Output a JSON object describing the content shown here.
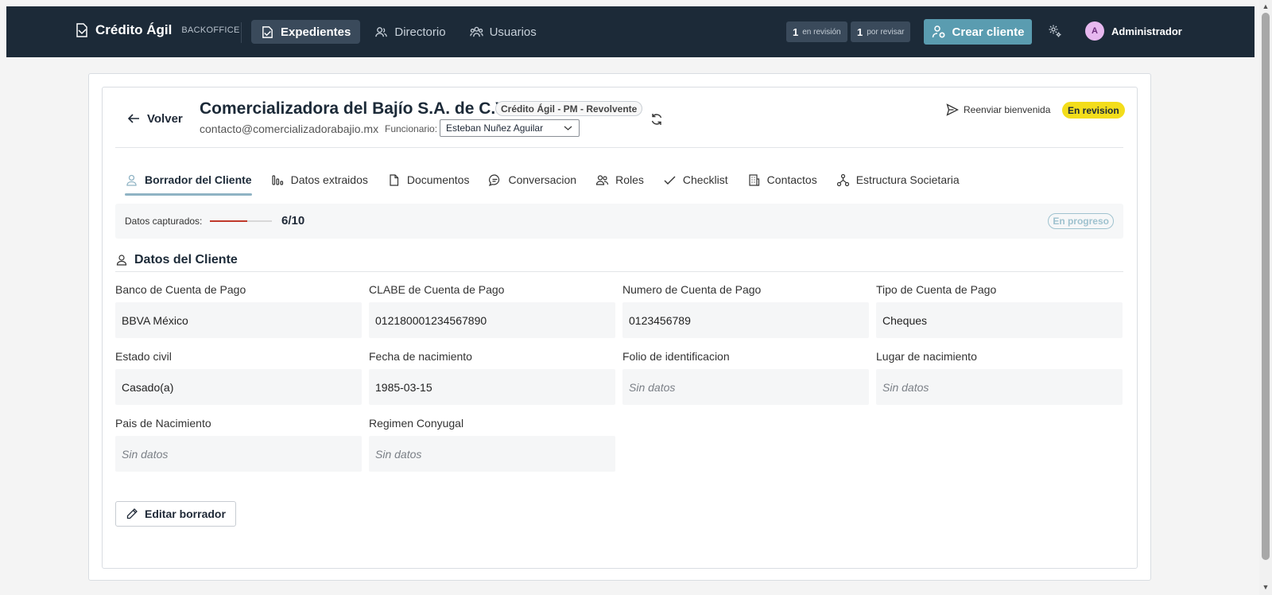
{
  "app": {
    "name": "Crédito Ágil",
    "subtitle": "BACKOFFICE"
  },
  "nav": {
    "items": [
      {
        "label": "Expedientes",
        "active": true,
        "icon": "folder-icon"
      },
      {
        "label": "Directorio",
        "active": false,
        "icon": "users-icon"
      },
      {
        "label": "Usuarios",
        "active": false,
        "icon": "group-icon"
      }
    ]
  },
  "counters": {
    "review": {
      "count": "1",
      "label": "en revisión"
    },
    "pending": {
      "count": "1",
      "label": "por revisar"
    }
  },
  "actions": {
    "create_client": "Crear cliente"
  },
  "user": {
    "initial": "A",
    "name": "Administrador"
  },
  "client": {
    "back_label": "Volver",
    "name": "Comercializadora del Bajío S.A. de C.V.",
    "product": "Crédito Ágil - PM - Revolvente",
    "email": "contacto@comercializadorabajio.mx",
    "officer_label": "Funcionario:",
    "officer_value": "Esteban Nuñez Aguilar",
    "resend_label": "Reenviar bienvenida",
    "status": "En revision"
  },
  "tabs": [
    {
      "label": "Borrador del Cliente",
      "icon": "user-icon",
      "active": true
    },
    {
      "label": "Datos extraidos",
      "icon": "bars-icon",
      "active": false
    },
    {
      "label": "Documentos",
      "icon": "document-icon",
      "active": false
    },
    {
      "label": "Conversacion",
      "icon": "chat-icon",
      "active": false
    },
    {
      "label": "Roles",
      "icon": "users-icon",
      "active": false
    },
    {
      "label": "Checklist",
      "icon": "check-icon",
      "active": false
    },
    {
      "label": "Contactos",
      "icon": "building-icon",
      "active": false
    },
    {
      "label": "Estructura Societaria",
      "icon": "hierarchy-icon",
      "active": false
    }
  ],
  "progress": {
    "label": "Datos capturados:",
    "captured": 6,
    "total": 10,
    "count_text": "6/10",
    "status": "En progreso",
    "color": "#c0392b"
  },
  "section": {
    "title": "Datos del Cliente",
    "fields": [
      {
        "label": "Banco de Cuenta de Pago",
        "value": "BBVA México",
        "empty": false
      },
      {
        "label": "CLABE de Cuenta de Pago",
        "value": "012180001234567890",
        "empty": false
      },
      {
        "label": "Numero de Cuenta de Pago",
        "value": "0123456789",
        "empty": false
      },
      {
        "label": "Tipo de Cuenta de Pago",
        "value": "Cheques",
        "empty": false
      },
      {
        "label": "Estado civil",
        "value": "Casado(a)",
        "empty": false
      },
      {
        "label": "Fecha de nacimiento",
        "value": "1985-03-15",
        "empty": false
      },
      {
        "label": "Folio de identificacion",
        "value": "Sin datos",
        "empty": true
      },
      {
        "label": "Lugar de nacimiento",
        "value": "Sin datos",
        "empty": true
      },
      {
        "label": "Pais de Nacimiento",
        "value": "Sin datos",
        "empty": true
      },
      {
        "label": "Regimen Conyugal",
        "value": "Sin datos",
        "empty": true
      }
    ],
    "edit_label": "Editar borrador"
  },
  "colors": {
    "topbar": "#1c2a38",
    "accent": "#5a9cb0",
    "status_badge": "#f3dd1b"
  }
}
